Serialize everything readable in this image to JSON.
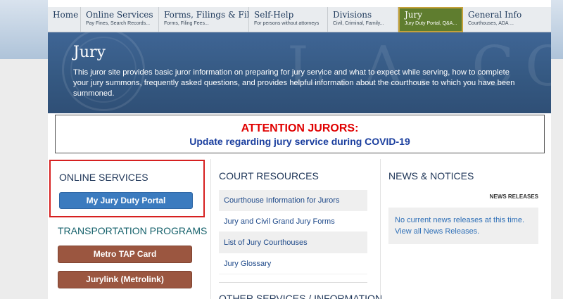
{
  "nav": [
    {
      "title": "Home",
      "sub": ""
    },
    {
      "title": "Online Services",
      "sub": "Pay Fines, Search Records..."
    },
    {
      "title": "Forms, Filings & Files",
      "sub": "Forms, Filing Fees..."
    },
    {
      "title": "Self-Help",
      "sub": "For persons without attorneys"
    },
    {
      "title": "Divisions",
      "sub": "Civil, Criminal, Family..."
    },
    {
      "title": "Jury",
      "sub": "Jury Duty Portal, Q&A..."
    },
    {
      "title": "General Info",
      "sub": "Courthouses, ADA ..."
    }
  ],
  "hero": {
    "title": "Jury",
    "text": "This juror site provides basic juror information on preparing for jury service and what to expect while serving, how to complete your jury summons, frequently asked questions, and provides helpful information about the courthouse to which you have been summoned.",
    "watermark": "L.A. COURT"
  },
  "attention": {
    "headline": "ATTENTION JURORS:",
    "link": "Update regarding jury service during COVID-19"
  },
  "online": {
    "title": "ONLINE SERVICES",
    "button": "My Jury Duty Portal"
  },
  "transport": {
    "title": "TRANSPORTATION PROGRAMS",
    "buttons": [
      "Metro TAP Card",
      "Jurylink (Metrolink)"
    ]
  },
  "court": {
    "title": "COURT RESOURCES",
    "items": [
      "Courthouse Information for Jurors",
      "Jury and Civil Grand Jury Forms",
      "List of Jury Courthouses",
      "Jury Glossary"
    ],
    "other_title": "OTHER SERVICES / INFORMATION"
  },
  "news": {
    "title": "NEWS & NOTICES",
    "subhead": "NEWS RELEASES",
    "message": "No current news releases at this time. View all News Releases."
  },
  "colors": {
    "active_nav": "#5f7d2f",
    "hero": "#355982",
    "attention_red": "#e00000",
    "attention_blue": "#1a3e9e",
    "portal_button": "#3b7bbf",
    "transport_button": "#9b5640",
    "highlight_border": "#d62020"
  }
}
